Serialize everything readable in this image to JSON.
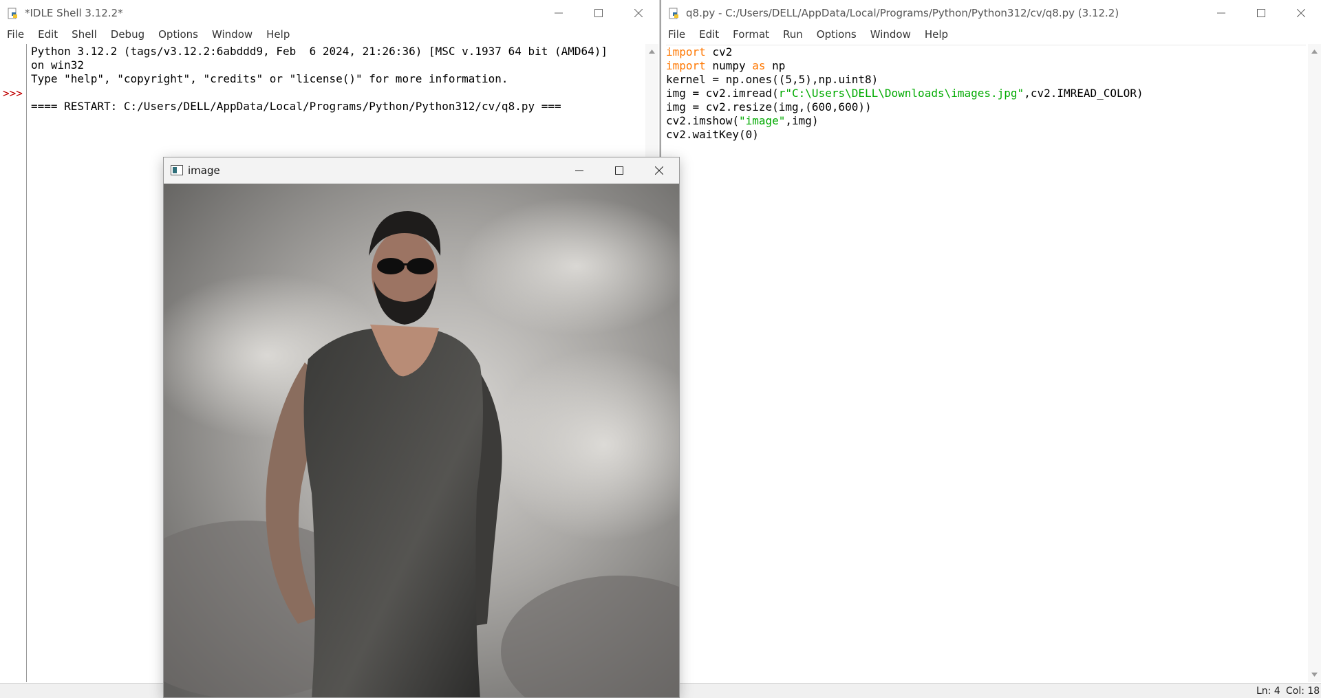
{
  "shell": {
    "title": "*IDLE Shell 3.12.2*",
    "menu": [
      "File",
      "Edit",
      "Shell",
      "Debug",
      "Options",
      "Window",
      "Help"
    ],
    "prompt": ">>>",
    "lines": [
      "Python 3.12.2 (tags/v3.12.2:6abddd9, Feb  6 2024, 21:26:36) [MSC v.1937 64 bit (AMD64)]",
      "on win32",
      "Type \"help\", \"copyright\", \"credits\" or \"license()\" for more information.",
      "",
      "==== RESTART: C:/Users/DELL/AppData/Local/Programs/Python/Python312/cv/q8.py ==="
    ]
  },
  "editor": {
    "title": "q8.py - C:/Users/DELL/AppData/Local/Programs/Python/Python312/cv/q8.py (3.12.2)",
    "menu": [
      "File",
      "Edit",
      "Format",
      "Run",
      "Options",
      "Window",
      "Help"
    ],
    "code": {
      "l1_kw": "import",
      "l1_rest": " cv2",
      "l2_kw": "import",
      "l2_mid": " numpy ",
      "l2_kw2": "as",
      "l2_rest": " np",
      "l3": "kernel = np.ones((5,5),np.uint8)",
      "l4_pre": "img = cv2.imread(",
      "l4_str": "r\"C:\\Users\\DELL\\Downloads\\images.jpg\"",
      "l4_post": ",cv2.IMREAD_COLOR)",
      "l5": "img = cv2.resize(img,(600,600))",
      "l6_pre": "cv2.imshow(",
      "l6_str": "\"image\"",
      "l6_post": ",img)",
      "l7": "cv2.waitKey(0)"
    },
    "status": {
      "line": "Ln: 4",
      "col": "Col: 18"
    }
  },
  "image_window": {
    "title": "image",
    "image_description_icon": "photo-of-man-in-sunglasses"
  },
  "colors": {
    "keyword": "#ff7700",
    "string": "#00aa00",
    "prompt": "#c00000"
  }
}
